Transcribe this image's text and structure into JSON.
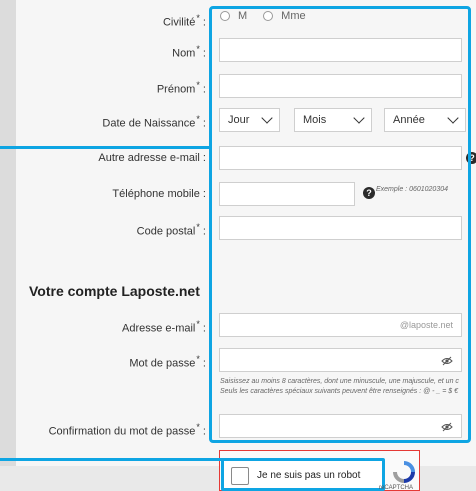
{
  "form": {
    "civilite_label": "Civilité",
    "nom_label": "Nom",
    "prenom_label": "Prénom",
    "date_label": "Date de Naissance",
    "autre_email_label": "Autre adresse e-mail",
    "telephone_label": "Téléphone mobile",
    "code_postal_label": "Code postal",
    "required_mark": "*",
    "radio_m": "M",
    "radio_mme": "Mme",
    "select_jour": "Jour",
    "select_mois": "Mois",
    "select_annee": "Année",
    "phone_example": "Exemple : 0601020304"
  },
  "account": {
    "section_title": "Votre compte Laposte.net",
    "email_label": "Adresse e-mail",
    "email_suffix": "@laposte.net",
    "password_label": "Mot de passe",
    "password_hint_1": "Saisissez au moins 8 caractères, dont une minuscule, une majuscule, et un c",
    "password_hint_2": "Seuls les caractères spéciaux suivants peuvent être renseignés : @ - _ = $ €",
    "confirm_label": "Confirmation du mot de passe"
  },
  "captcha": {
    "label": "Je ne suis pas un robot",
    "brand": "reCAPTCHA"
  },
  "colors": {
    "highlight": "#0ea5e3",
    "captcha_error_border": "#e53935"
  }
}
